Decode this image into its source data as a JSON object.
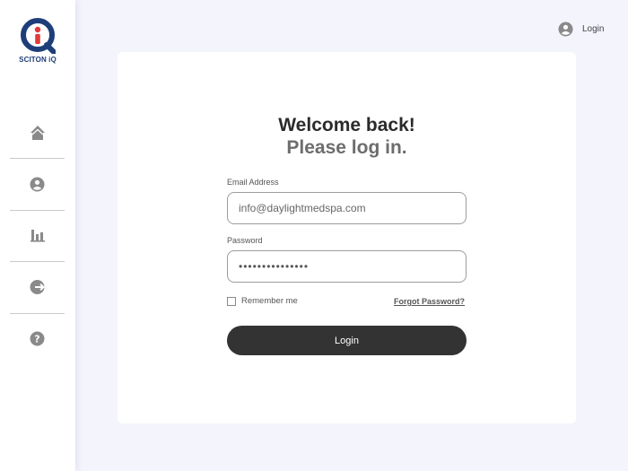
{
  "brand": {
    "name": "SCITON iQ",
    "mark": "i"
  },
  "sidebar": {
    "items": [
      {
        "name": "home",
        "icon": "home-icon"
      },
      {
        "name": "account",
        "icon": "user-circle-icon"
      },
      {
        "name": "reports",
        "icon": "bar-chart-icon"
      },
      {
        "name": "logout",
        "icon": "logout-arrow-icon"
      },
      {
        "name": "help",
        "icon": "help-question-icon"
      }
    ]
  },
  "header": {
    "login_label": "Login",
    "login_icon": "user-circle-icon"
  },
  "form": {
    "title": "Welcome back!",
    "subtitle": "Please log in.",
    "email_label": "Email Address",
    "email_value": "info@daylightmedspa.com",
    "password_label": "Password",
    "password_masked": "•••••••••••••••",
    "remember_label": "Remember me",
    "remember_checked": false,
    "forgot_label": "Forgot Password?",
    "submit_label": "Login"
  },
  "colors": {
    "background": "#f3f4fc",
    "brand_blue": "#1e3e7a",
    "brand_red": "#e23a3a",
    "button": "#333333",
    "icon_gray": "#8a8a8a"
  }
}
